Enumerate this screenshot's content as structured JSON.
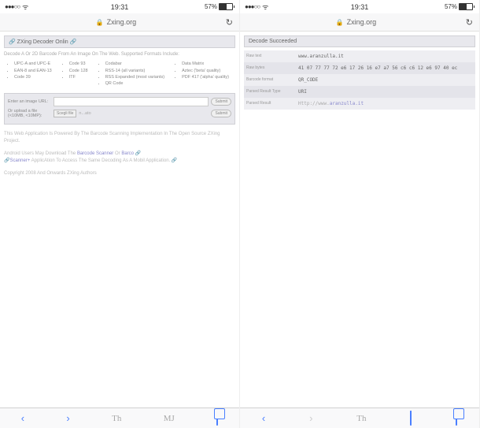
{
  "status": {
    "time": "19:31",
    "battery_pct": "57%",
    "signal": "●●●○○",
    "wifi": "⚡"
  },
  "left": {
    "url": "Zxing.org",
    "header": "ZXing Decoder Onlin",
    "desc": "Decode A Or 2D Barcode From An Image On The Web. Supported Formats Include:",
    "formats_col1": [
      "UPC-A and UPC-E",
      "EAN-8 and EAN-13",
      "Code 39"
    ],
    "formats_col2": [
      "Code 93",
      "Code 128",
      "ITF"
    ],
    "formats_col3": [
      "Codabar",
      "RSS-14 (all variants)",
      "RSS Expanded (most variants)",
      "QR Code"
    ],
    "formats_col4": [
      "Data Matrix",
      "Aztec ('beta' quality)",
      "PDF 417 ('alpha' quality)"
    ],
    "url_label": "Enter an image URL:",
    "file_label": "Or upload a file (<10MB, <10MP):",
    "choose_btn": "Scegli file",
    "no_file": "n...ato",
    "submit": "Submit",
    "foot1": "This Web Application Is Powered By The Barcode Scanning Implementation In The Open Source ZXing Project.",
    "foot2_a": "Android Users May Download The ",
    "foot2_link1": "Barcode Scanner",
    "foot2_b": " Or ",
    "foot2_link2": "Barco",
    "foot2_link3": "Scanner+",
    "foot2_c": " ApplicAtion To Access The Same Decoding As A Mobil Application.",
    "foot3": "Copyright 2008 And Onwards ZXing Authors"
  },
  "right": {
    "url": "Zxing.org",
    "header": "Decode Succeeded",
    "rows": [
      {
        "label": "Raw text",
        "value": "www.aranzulla.it"
      },
      {
        "label": "Raw bytes",
        "value": "41 07 77 77 72 e6 17 26  16 e7 a7 56 c6 c6 12 e6 97 40 ec"
      },
      {
        "label": "Barcode format",
        "value": "QR_CODE"
      },
      {
        "label": "Parsed Result Type",
        "value": "URI"
      },
      {
        "label": "Parsed Result",
        "value": "Http://www.aranzulla.it",
        "link": true,
        "linkpart": "aranzulla.it"
      }
    ]
  },
  "toolbar": {
    "share": "Th",
    "bookmarks": "MJ"
  }
}
